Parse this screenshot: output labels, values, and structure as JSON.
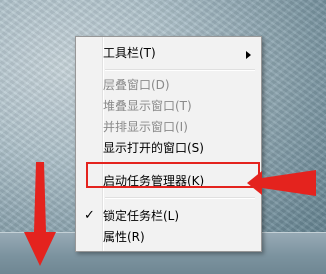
{
  "context_menu": {
    "items": [
      {
        "label": "工具栏(T)",
        "enabled": true,
        "has_submenu": true
      },
      {
        "label": "层叠窗口(D)",
        "enabled": false
      },
      {
        "label": "堆叠显示窗口(T)",
        "enabled": false
      },
      {
        "label": "并排显示窗口(I)",
        "enabled": false
      },
      {
        "label": "显示打开的窗口(S)",
        "enabled": true
      },
      {
        "label": "启动任务管理器(K)",
        "enabled": true,
        "highlighted": true
      },
      {
        "label": "锁定任务栏(L)",
        "enabled": true,
        "checked": true
      },
      {
        "label": "属性(R)",
        "enabled": true
      }
    ],
    "check_glyph": "✓"
  },
  "annotation": {
    "color": "#e4231e"
  }
}
